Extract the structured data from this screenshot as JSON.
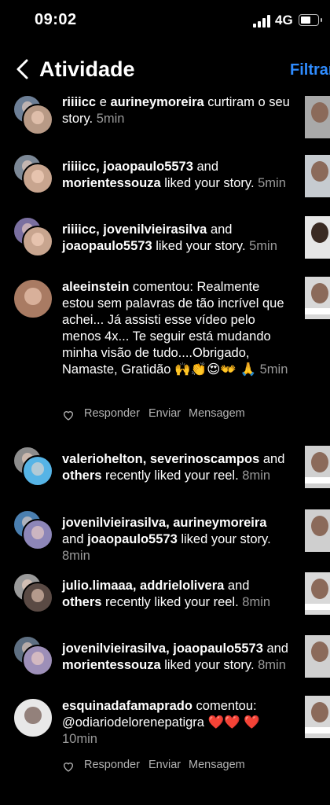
{
  "status": {
    "time": "09:02",
    "network": "4G"
  },
  "header": {
    "title": "Atividade",
    "filter": "Filtrar"
  },
  "rows": [
    {
      "users": "riiiicc",
      "sep": " e ",
      "users2": "aurineymoreira",
      "action": " curtiram o seu story.",
      "time": " 5min"
    },
    {
      "users": "riiiicc, joaopaulo5573",
      "sep": " and ",
      "users2": "morientessouza",
      "action": " liked your story.",
      "time": " 5min"
    },
    {
      "users": "riiiicc, jovenilvieirasilva",
      "sep": " and ",
      "users2": "joaopaulo5573",
      "action": " liked your story.",
      "time": " 5min"
    },
    {
      "users": "aleeinstein",
      "action": " comentou: Realmente estou sem palavras de tão incrível que achei... Já assisti esse vídeo pelo menos 4x... Te seguir está mudando minha visão de tudo....Obrigado, Namaste,  Gratidão 🙌👏😍👐 🙏",
      "time": " 5min"
    },
    {
      "users": "valeriohelton, severinoscampos",
      "sep": " and ",
      "users2": "others",
      "action": " recently liked your reel.",
      "time": " 8min"
    },
    {
      "users": "jovenilvieirasilva, aurineymoreira",
      "sep": " and ",
      "users2": "joaopaulo5573",
      "action": " liked your story.",
      "time": " 8min"
    },
    {
      "users": "julio.limaaa, addrielolivera",
      "sep": " and ",
      "users2": "others",
      "action": " recently liked your reel.",
      "time": " 8min"
    },
    {
      "users": "jovenilvieirasilva, joaopaulo5573",
      "sep": " and ",
      "users2": "morientessouza",
      "action": " liked your story.",
      "time": " 8min"
    },
    {
      "users": "esquinadafamaprado",
      "action": " comentou: @odiariodelorenepatigra ❤️❤️ ❤️",
      "time": " 10min"
    }
  ],
  "comment_actions": {
    "reply": "Responder",
    "send": "Enviar",
    "message": "Mensagem"
  },
  "colors": {
    "accent": "#2f8cff",
    "muted": "#9a9a9a"
  }
}
